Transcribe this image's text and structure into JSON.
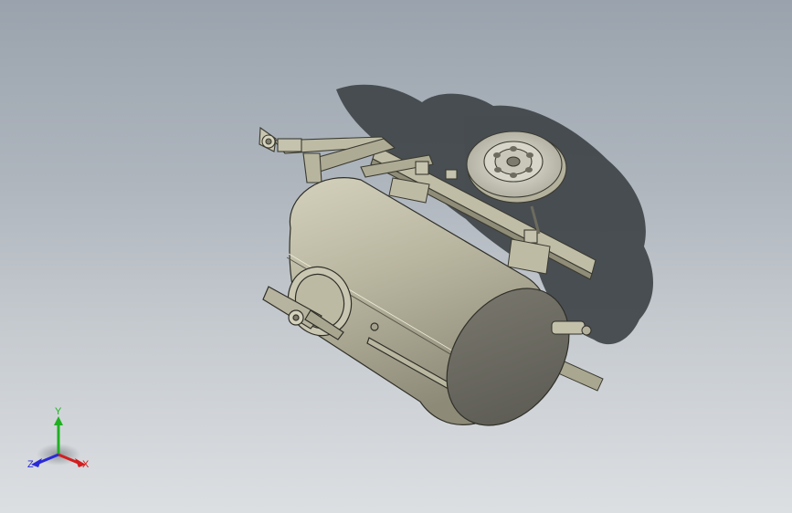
{
  "viewport": {
    "background_top": "#9aa3ad",
    "background_bottom": "#dcdfe2"
  },
  "model": {
    "body_color": "#bdbaa4",
    "shadow_color": "#3d4246"
  },
  "triad": {
    "x_label": "X",
    "y_label": "Y",
    "z_label": "Z",
    "x_color": "#d21e1e",
    "y_color": "#21b021",
    "z_color": "#2a2ad6"
  }
}
